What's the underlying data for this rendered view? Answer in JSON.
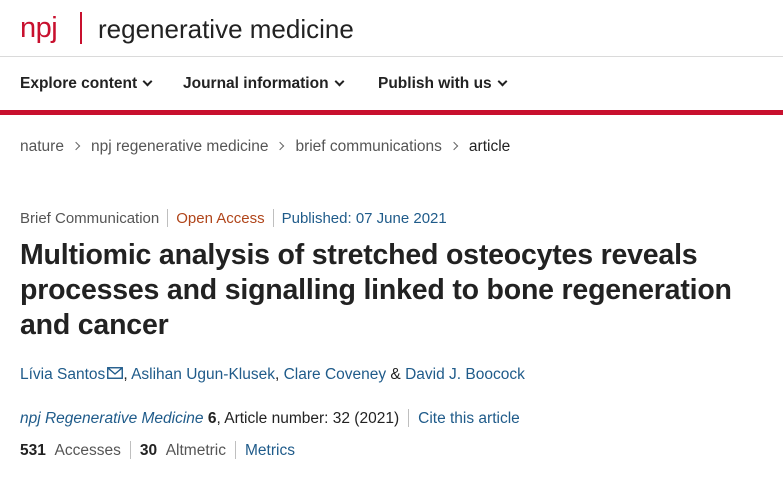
{
  "brand": {
    "abbrev": "npj",
    "title": "regenerative medicine"
  },
  "nav": {
    "items": [
      {
        "label": "Explore content"
      },
      {
        "label": "Journal information"
      },
      {
        "label": "Publish with us"
      }
    ]
  },
  "breadcrumbs": [
    "nature",
    "npj regenerative medicine",
    "brief communications",
    "article"
  ],
  "article": {
    "type": "Brief Communication",
    "access": "Open Access",
    "published": "Published: 07 June 2021",
    "title": "Multiomic analysis of stretched osteocytes reveals processes and signalling linked to bone regeneration and cancer",
    "authors": [
      "Lívia Santos",
      "Aslihan Ugun-Klusek",
      "Clare Coveney",
      "David J. Boocock"
    ],
    "author_sep": ", ",
    "author_and": " & ",
    "journal": "npj Regenerative Medicine",
    "volume": "6",
    "article_number": ", Article number: 32 (2021)",
    "cite_label": "Cite this article"
  },
  "metrics": {
    "accesses_value": "531",
    "accesses_label": "Accesses",
    "altmetric_value": "30",
    "altmetric_label": "Altmetric",
    "metrics_link": "Metrics"
  },
  "icons": {
    "nav_chevron": "chevron-down-icon",
    "breadcrumb_chevron": "chevron-right-icon",
    "author_mail": "mail-icon"
  },
  "colors": {
    "brand_red": "#c8102e",
    "link_blue": "#1f5b8a",
    "open_access": "#b0451a"
  }
}
